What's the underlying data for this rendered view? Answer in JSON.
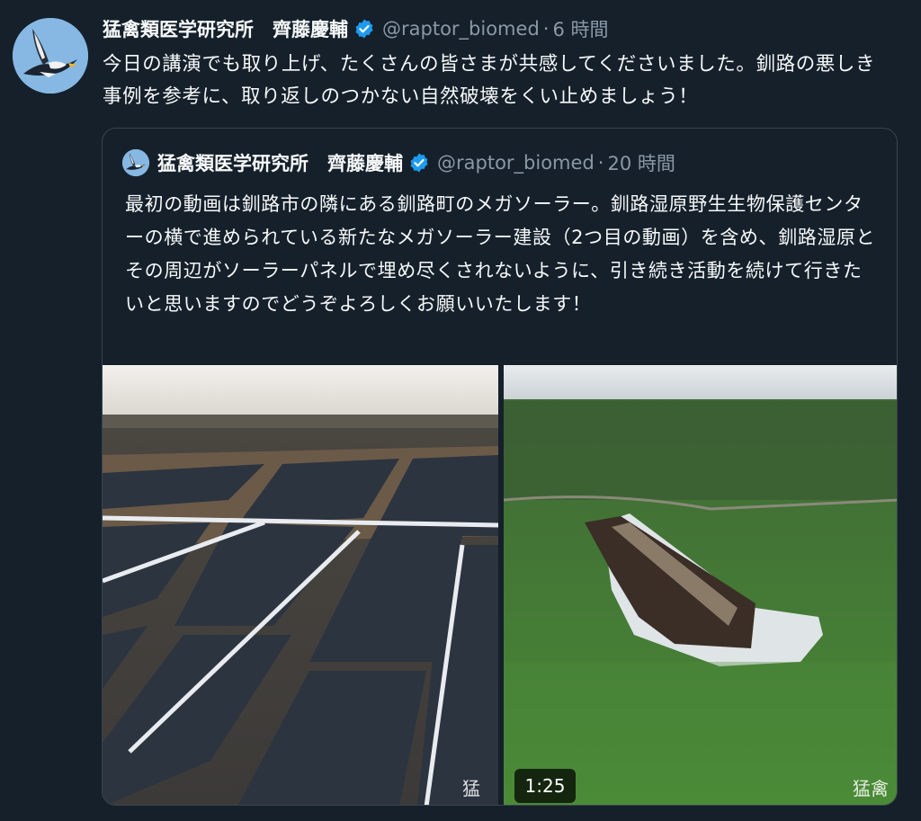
{
  "tweet": {
    "author_name": "猛禽類医学研究所　齊藤慶輔",
    "handle": "@raptor_biomed",
    "separator": "·",
    "time": "6 時間",
    "text": "今日の講演でも取り上げ、たくさんの皆さまが共感してくださいました。釧路の悪しき事例を参考に、取り返しのつかない自然破壊をくい止めましょう！"
  },
  "quote": {
    "author_name": "猛禽類医学研究所　齊藤慶輔",
    "handle": "@raptor_biomed",
    "separator": "·",
    "time": "20 時間",
    "text": "最初の動画は釧路市の隣にある釧路町のメガソーラー。釧路湿原野生生物保護センターの横で進められている新たなメガソーラー建設（2つ目の動画）を含め、釧路湿原とその周辺がソーラーパネルで埋め尽くされないように、引き続き活動を続けて行きたいと思いますのでどうぞよろしくお願いいたします！",
    "media": {
      "video_duration": "1:25",
      "watermark_left": "猛",
      "watermark_right": "猛禽"
    }
  },
  "colors": {
    "background": "#15202b",
    "text": "#f7f9f9",
    "secondary_text": "#8b98a5",
    "verified": "#1d9bf0",
    "border": "#38444d"
  },
  "icons": {
    "verified": "verified-badge-icon",
    "avatar": "eagle-avatar"
  }
}
